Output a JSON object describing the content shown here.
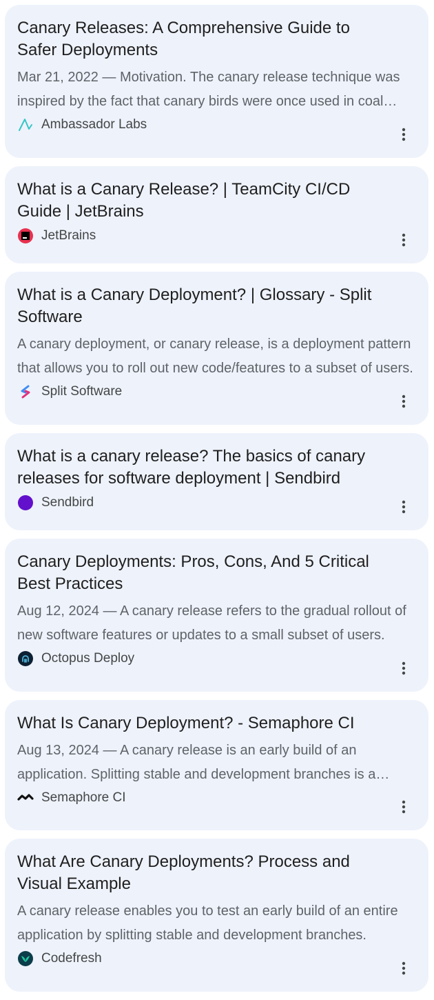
{
  "results": [
    {
      "title": "Canary Releases: A Comprehensive Guide to Safer Deployments",
      "snippet": "Mar 21, 2022 — Motivation. The canary release technique was inspired by the fact that canary birds were once used in coal mines to alert miners.",
      "source": "Ambassador Labs",
      "icon": "ambassador-logo-icon"
    },
    {
      "title": "What is a Canary Release? | TeamCity CI/CD Guide | JetBrains",
      "snippet": "",
      "source": "JetBrains",
      "icon": "jetbrains-logo-icon"
    },
    {
      "title": "What is a Canary Deployment? | Glossary - Split Software",
      "snippet": "A canary deployment, or canary release, is a deployment pattern that allows you to roll out new code/features to a subset of users.",
      "source": "Split Software",
      "icon": "split-logo-icon"
    },
    {
      "title": "What is a canary release? The basics of canary releases for software deployment | Sendbird",
      "snippet": "",
      "source": "Sendbird",
      "icon": "sendbird-logo-icon"
    },
    {
      "title": "Canary Deployments: Pros, Cons, And 5 Critical Best Practices",
      "snippet": "Aug 12, 2024 — A canary release refers to the gradual rollout of new software features or updates to a small subset of users.",
      "source": "Octopus Deploy",
      "icon": "octopus-logo-icon"
    },
    {
      "title": "What Is Canary Deployment? - Semaphore CI",
      "snippet": "Aug 13, 2024 — A canary release is an early build of an application. Splitting stable and development branches is a widespread strategy.",
      "source": "Semaphore CI",
      "icon": "semaphore-logo-icon"
    },
    {
      "title": "What Are Canary Deployments? Process and Visual Example",
      "snippet": "A canary release enables you to test an early build of an entire application by splitting stable and development branches.",
      "source": "Codefresh",
      "icon": "codefresh-logo-icon"
    }
  ]
}
